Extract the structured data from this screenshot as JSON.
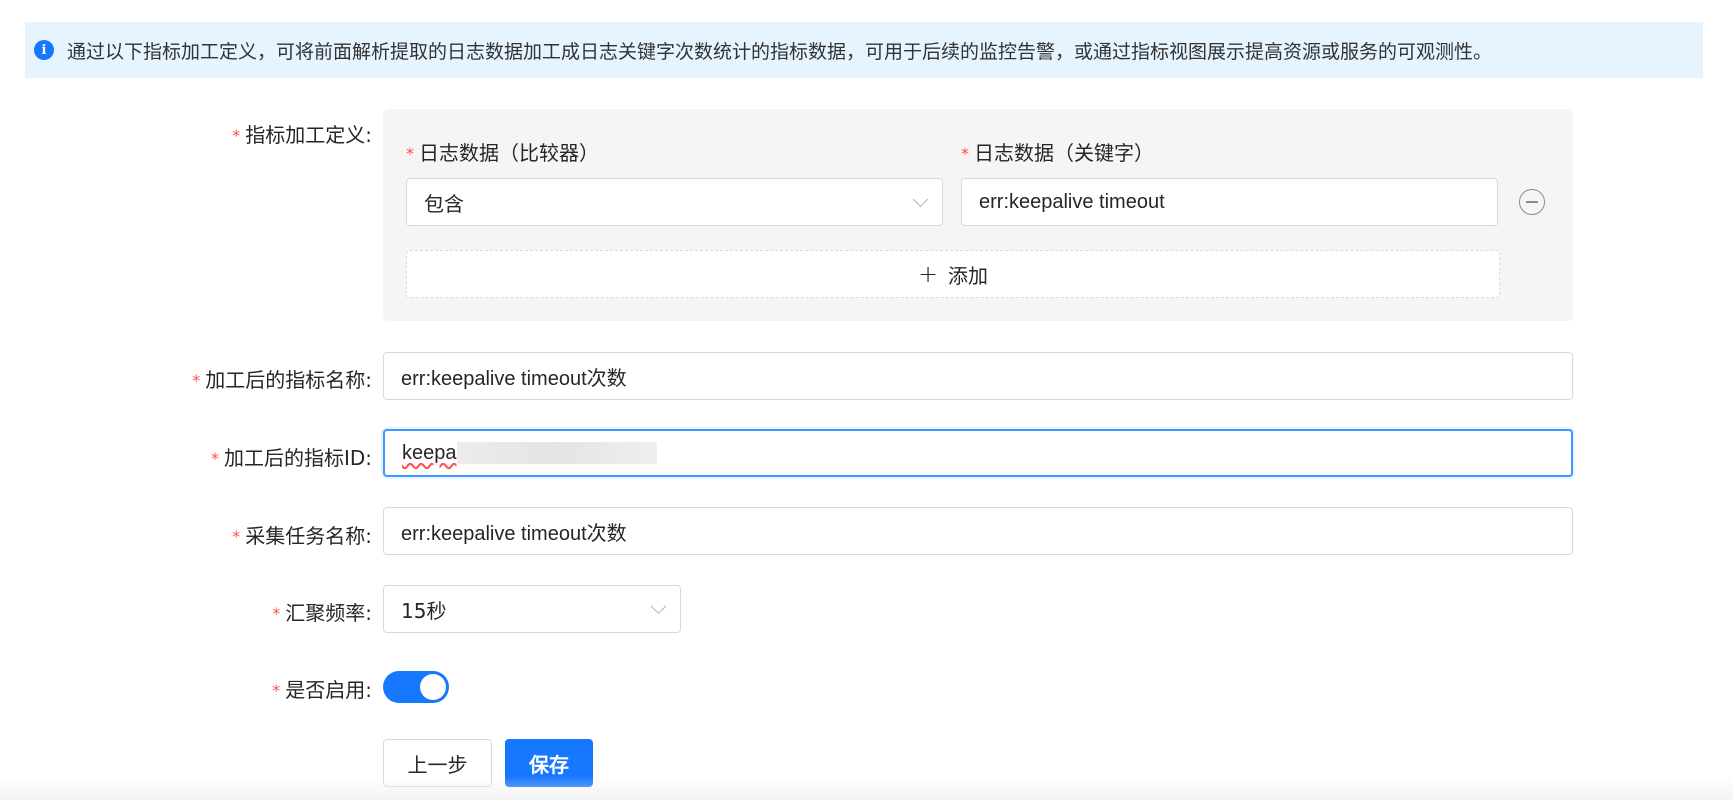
{
  "banner": {
    "icon": "info-icon",
    "text": "通过以下指标加工定义，可将前面解析提取的日志数据加工成日志关键字次数统计的指标数据，可用于后续的监控告警，或通过指标视图展示提高资源或服务的可观测性。"
  },
  "form": {
    "required_mark": "*",
    "metric_definition": {
      "label": "指标加工定义:",
      "comparator_label": "日志数据（比较器）",
      "keyword_label": "日志数据（关键字）",
      "comparator_value": "包含",
      "keyword_value": "err:keepalive timeout",
      "add_label": "添加",
      "add_icon": "plus-icon",
      "remove_icon": "minus-circle-icon"
    },
    "metric_name": {
      "label": "加工后的指标名称:",
      "value": "err:keepalive timeout次数"
    },
    "metric_id": {
      "label": "加工后的指标ID:",
      "value": "keepa"
    },
    "task_name": {
      "label": "采集任务名称:",
      "value": "err:keepalive timeout次数"
    },
    "frequency": {
      "label": "汇聚频率:",
      "value": "15秒"
    },
    "enabled": {
      "label": "是否启用:",
      "on": true
    }
  },
  "actions": {
    "prev_label": "上一步",
    "save_label": "保存"
  },
  "colors": {
    "primary": "#1677ff",
    "banner_bg": "#e6f4ff",
    "required": "#ff4d4f"
  }
}
